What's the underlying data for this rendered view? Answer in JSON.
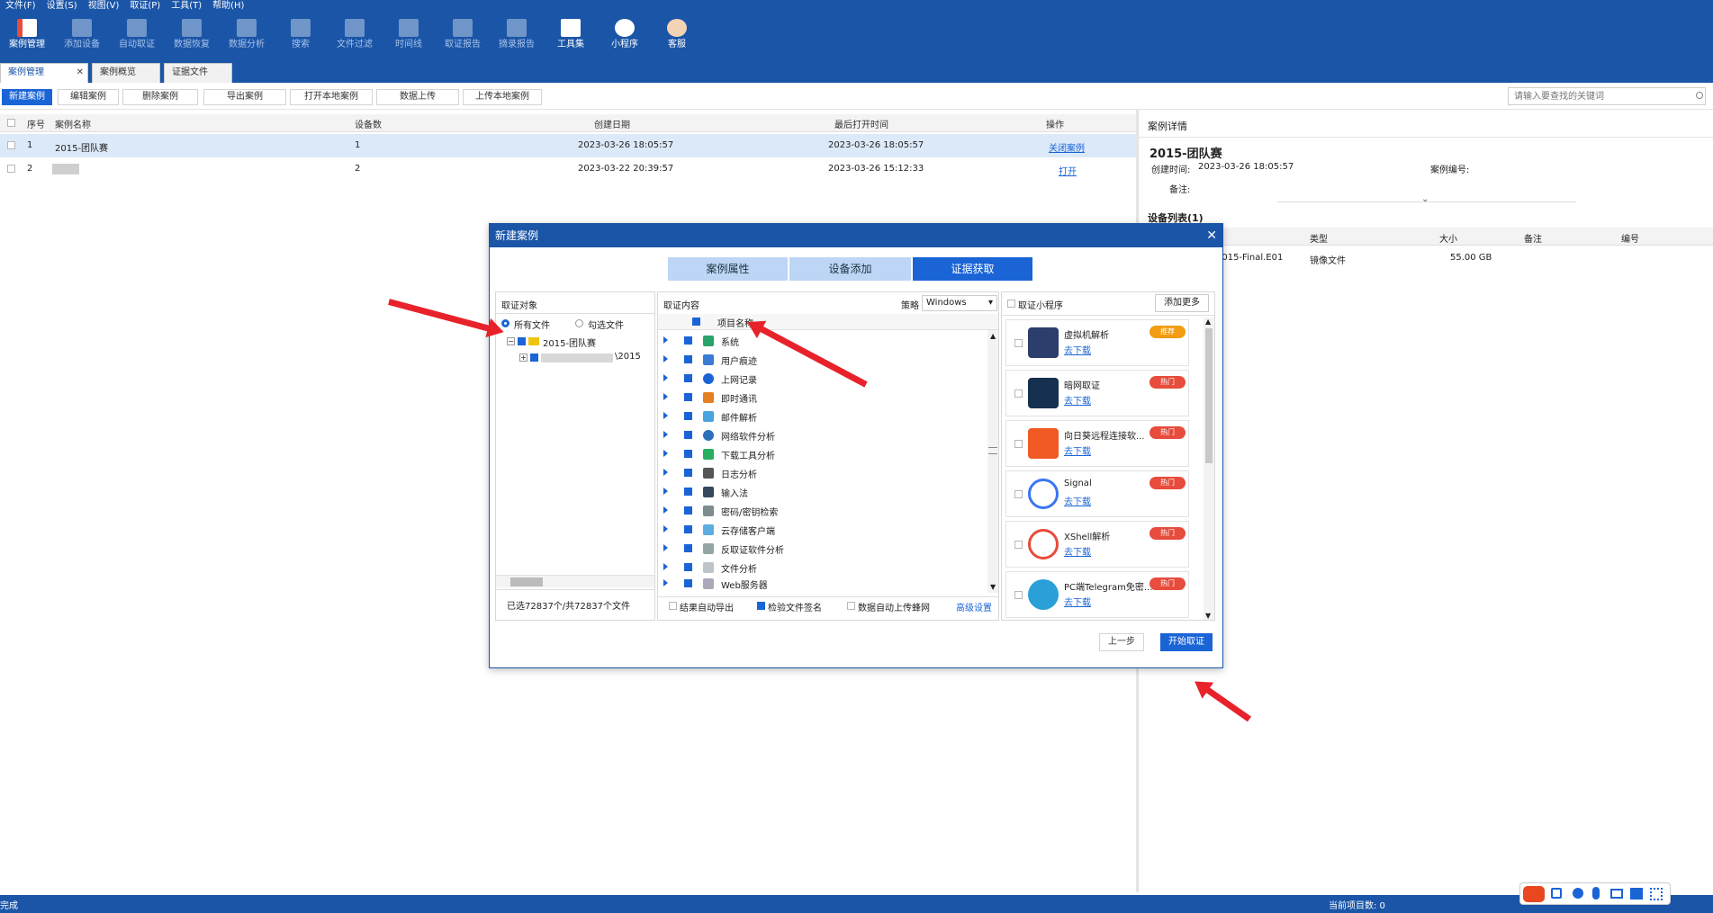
{
  "menubar": [
    "文件(F)",
    "设置(S)",
    "视图(V)",
    "取证(P)",
    "工具(T)",
    "帮助(H)"
  ],
  "toolbar": [
    {
      "label": "案例管理",
      "icon": "case-icon",
      "active": true
    },
    {
      "label": "添加设备",
      "icon": "add-device-icon",
      "active": false
    },
    {
      "label": "自动取证",
      "icon": "auto-icon",
      "active": false
    },
    {
      "label": "数据恢复",
      "icon": "recover-icon",
      "active": false
    },
    {
      "label": "数据分析",
      "icon": "analysis-icon",
      "active": false
    },
    {
      "label": "搜索",
      "icon": "search-icon",
      "active": false
    },
    {
      "label": "文件过滤",
      "icon": "filter-icon",
      "active": false
    },
    {
      "label": "时间线",
      "icon": "timeline-icon",
      "active": false
    },
    {
      "label": "取证报告",
      "icon": "report-icon",
      "active": false
    },
    {
      "label": "摘录报告",
      "icon": "excerpt-icon",
      "active": false
    },
    {
      "label": "工具集",
      "icon": "toolset-icon",
      "active": true
    },
    {
      "label": "小程序",
      "icon": "miniapp-icon",
      "active": true
    },
    {
      "label": "客服",
      "icon": "support-icon",
      "active": true
    }
  ],
  "tabs": [
    {
      "label": "案例管理",
      "close": "✕"
    },
    {
      "label": "案例概览"
    },
    {
      "label": "证据文件"
    }
  ],
  "actions": [
    "新建案例",
    "编辑案例",
    "删除案例",
    "导出案例",
    "打开本地案例",
    "数据上传",
    "上传本地案例"
  ],
  "search_placeholder": "请输入要查找的关键词",
  "table": {
    "headers": [
      "序号",
      "案例名称",
      "设备数",
      "创建日期",
      "最后打开时间",
      "操作"
    ],
    "rows": [
      {
        "no": "1",
        "name": "2015-团队赛",
        "devices": "1",
        "created": "2023-03-26 18:05:57",
        "opened": "2023-03-26 18:05:57",
        "op": "关闭案例"
      },
      {
        "no": "2",
        "name": "",
        "devices": "2",
        "created": "2023-03-22 20:39:57",
        "opened": "2023-03-26 15:12:33",
        "op": "打开"
      }
    ]
  },
  "details": {
    "header": "案例详情",
    "title": "2015-团队赛",
    "created_label": "创建时间:",
    "created": "2023-03-26 18:05:57",
    "number_label": "案例编号:",
    "note_label": "备注:",
    "devices_title": "设备列表(1)",
    "dev_headers": [
      "类型",
      "大小",
      "备注",
      "编号"
    ],
    "dev_row": {
      "name": "2015-Final.E01",
      "type": "镜像文件",
      "size": "55.00 GB"
    }
  },
  "status": {
    "left": "完成",
    "right": "当前项目数: 0"
  },
  "dialog": {
    "title": "新建案例",
    "close": "✕",
    "steps": [
      "案例属性",
      "设备添加",
      "证据获取"
    ],
    "target": {
      "title": "取证对象",
      "opt_all": "所有文件",
      "opt_checked": "勾选文件",
      "tree_root": "2015-团队赛",
      "tree_child": "\\2015",
      "summary": "已选72837个/共72837个文件"
    },
    "content": {
      "title": "取证内容",
      "strategy_label": "策略",
      "strategy": "Windows",
      "col": "项目名称",
      "items": [
        "系统",
        "用户痕迹",
        "上网记录",
        "即时通讯",
        "邮件解析",
        "网络软件分析",
        "下载工具分析",
        "日志分析",
        "输入法",
        "密码/密钥检索",
        "云存储客户端",
        "反取证软件分析",
        "文件分析",
        "Web服务器"
      ],
      "opt1": "结果自动导出",
      "opt2": "检验文件签名",
      "opt3": "数据自动上传蜂网",
      "advanced": "高级设置"
    },
    "miniapps": {
      "title": "取证小程序",
      "more": "添加更多",
      "download": "去下载",
      "apps": [
        {
          "name": "虚拟机解析",
          "badge": "推荐",
          "logo": "vm-icon"
        },
        {
          "name": "暗网取证",
          "badge": "热门",
          "logo": "darkweb-icon"
        },
        {
          "name": "向日葵远程连接软...",
          "badge": "热门",
          "logo": "sunlogin-icon"
        },
        {
          "name": "Signal",
          "badge": "热门",
          "logo": "signal-icon"
        },
        {
          "name": "XShell解析",
          "badge": "热门",
          "logo": "xshell-icon"
        },
        {
          "name": "PC端Telegram免密...",
          "badge": "热门",
          "logo": "telegram-icon"
        }
      ]
    },
    "prev": "上一步",
    "start": "开始取证"
  },
  "colors": {
    "primary": "#1a55a8",
    "accent": "#1a64d6",
    "arrow": "#e8222a",
    "hot": "#e74c3c",
    "rec": "#f39c12"
  }
}
